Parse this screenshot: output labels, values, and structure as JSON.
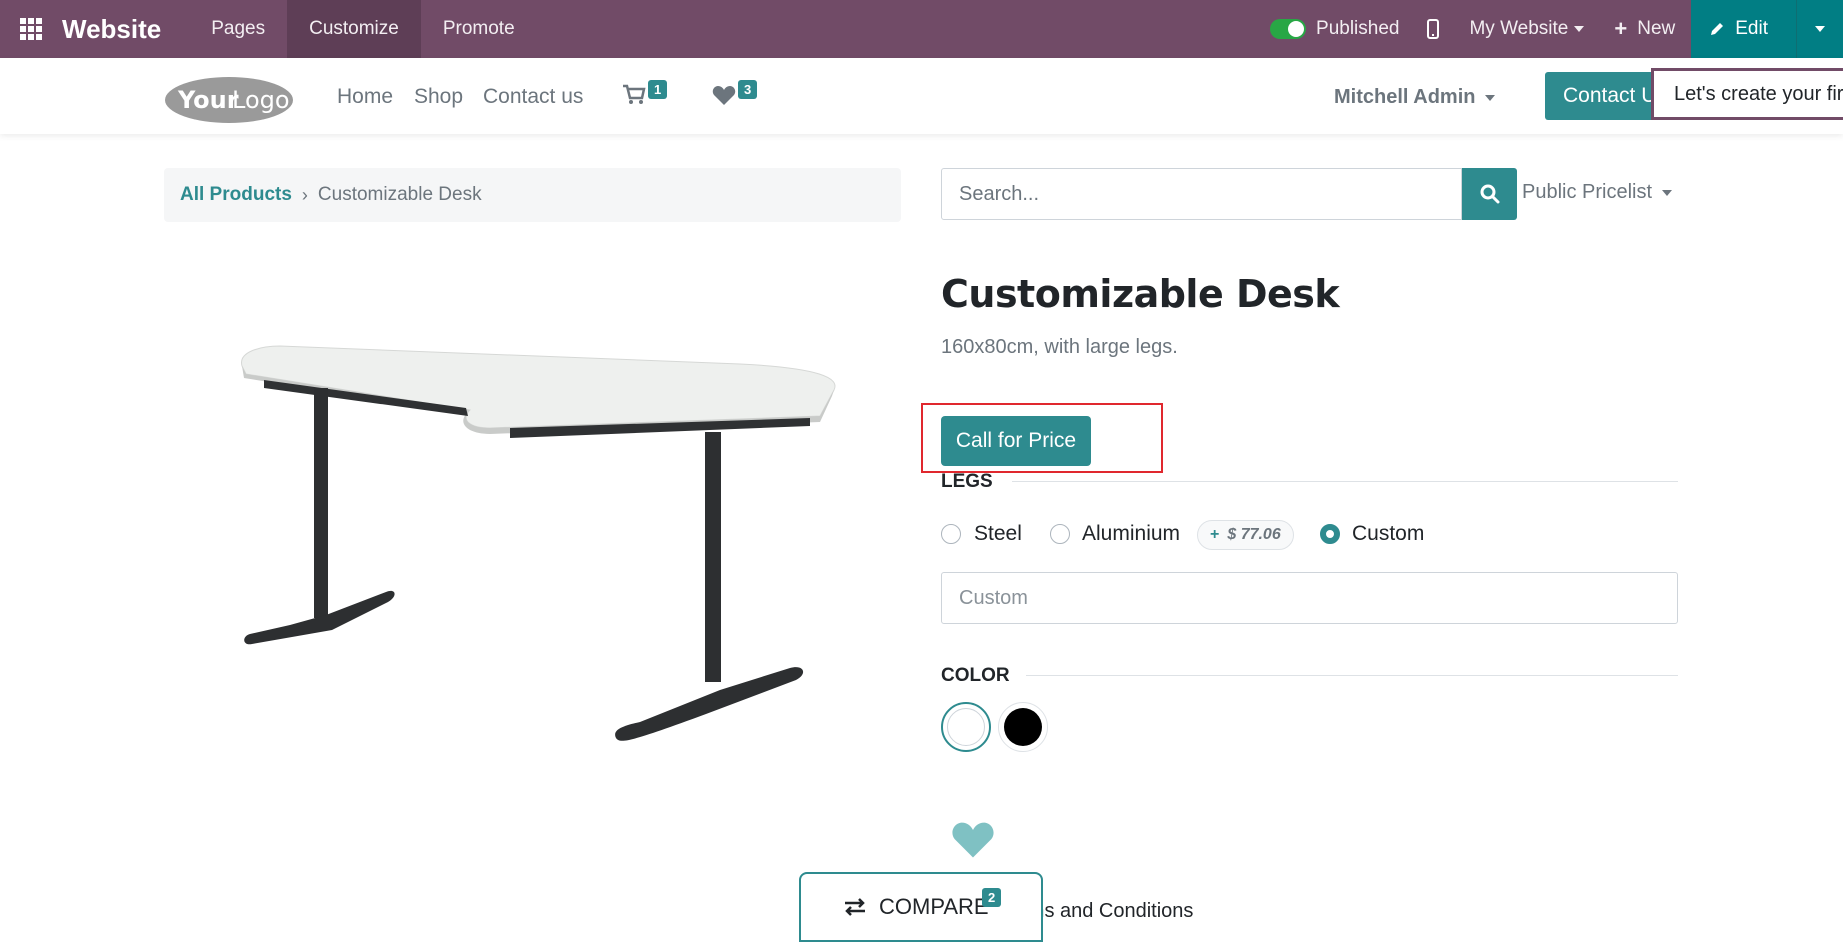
{
  "topbar": {
    "brand": "Website",
    "menu": [
      "Pages",
      "Customize",
      "Promote"
    ],
    "published_label": "Published",
    "website_selector": "My Website",
    "new_label": "New",
    "edit_label": "Edit"
  },
  "header": {
    "logo_text_your": "Your",
    "logo_text_logo": "Logo",
    "nav": [
      "Home",
      "Shop",
      "Contact us"
    ],
    "cart_count": "1",
    "wishlist_count": "3",
    "user_name": "Mitchell Admin",
    "contact_button": "Contact Us",
    "tour_tooltip": "Let's create your first product."
  },
  "breadcrumb": {
    "all_products": "All Products",
    "current": "Customizable Desk"
  },
  "search": {
    "placeholder": "Search...",
    "pricelist": "Public Pricelist"
  },
  "product": {
    "title": "Customizable Desk",
    "description": "160x80cm, with large legs.",
    "price_button": "Call for Price",
    "legs": {
      "title": "LEGS",
      "options": [
        {
          "label": "Steel",
          "checked": false
        },
        {
          "label": "Aluminium",
          "checked": false,
          "extra": "$ 77.06"
        },
        {
          "label": "Custom",
          "checked": true
        }
      ],
      "custom_placeholder": "Custom"
    },
    "color": {
      "title": "COLOR",
      "swatches": [
        "#ffffff",
        "#000000"
      ]
    },
    "terms_text": "Terms and Conditions"
  },
  "compare": {
    "label": "COMPARE",
    "count": "2"
  },
  "colors": {
    "admin_bar": "#714b67",
    "accent": "#2e8b8f",
    "highlight": "#e0282e"
  }
}
